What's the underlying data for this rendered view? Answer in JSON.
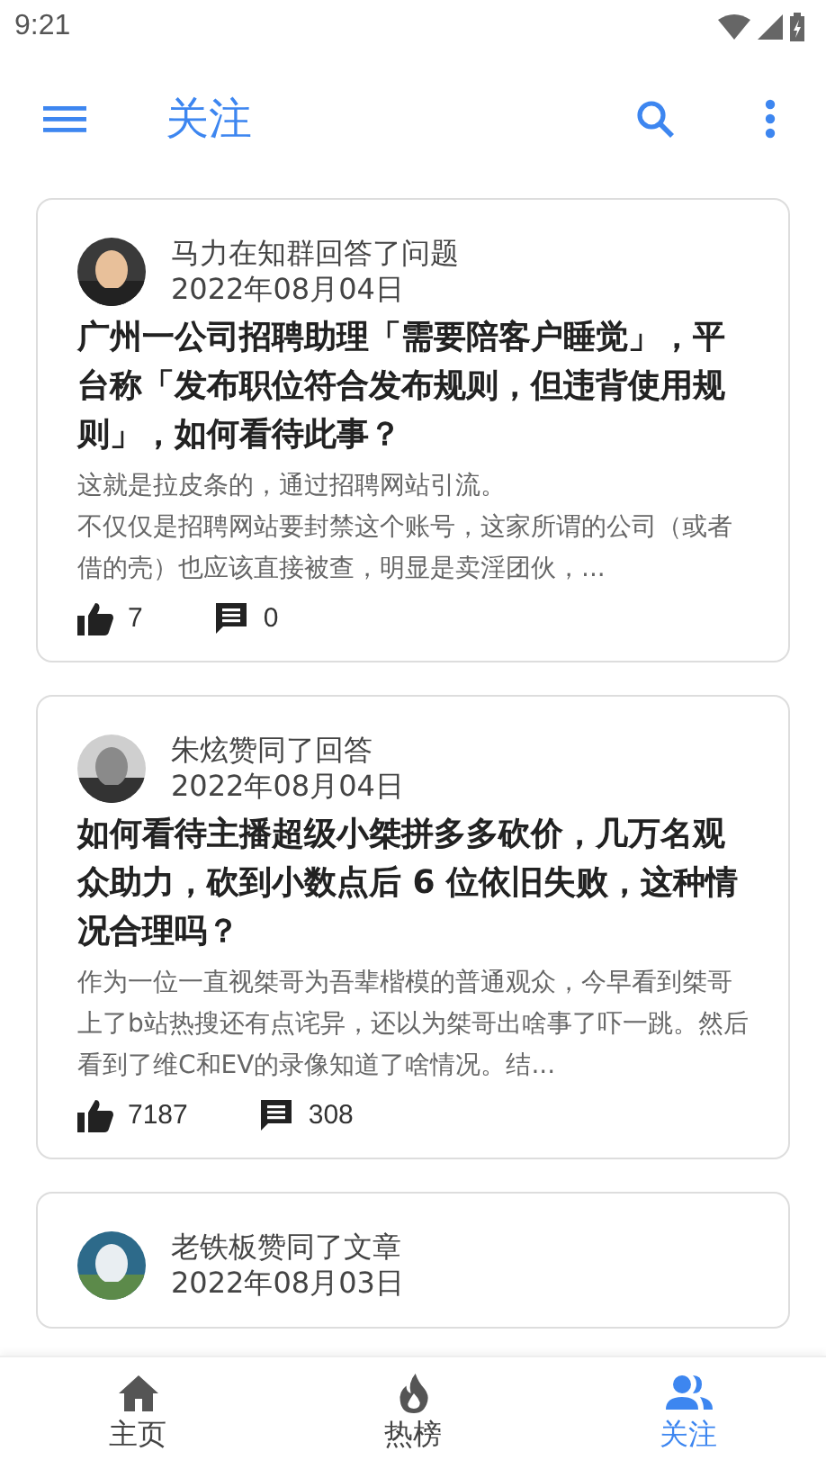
{
  "status_bar": {
    "time": "9:21"
  },
  "app_bar": {
    "title": "关注"
  },
  "feed": [
    {
      "activity": "马力在知群回答了问题",
      "date": "2022年08月04日",
      "title": "广州一公司招聘助理「需要陪客户睡觉」，平台称「发布职位符合发布规则，但违背使用规则」，如何看待此事？",
      "excerpt_lines": [
        "这就是拉皮条的，通过招聘网站引流。",
        "不仅仅是招聘网站要封禁这个账号，这家所谓的公司（或者借的壳）也应该直接被查，明显是卖淫团伙，..."
      ],
      "likes": "7",
      "comments": "0"
    },
    {
      "activity": "朱炫赞同了回答",
      "date": "2022年08月04日",
      "title": "如何看待主播超级小桀拼多多砍价，几万名观众助力，砍到小数点后 6 位依旧失败，这种情况合理吗？",
      "excerpt_lines": [
        "作为一位一直视桀哥为吾辈楷模的普通观众，今早看到桀哥上了b站热搜还有点诧异，还以为桀哥出啥事了吓一跳。然后看到了维C和EV的录像知道了啥情况。结..."
      ],
      "likes": "7187",
      "comments": "308"
    },
    {
      "activity": "老铁板赞同了文章",
      "date": "2022年08月03日"
    }
  ],
  "bottom_nav": [
    {
      "label": "主页",
      "kind": "home",
      "selected": false
    },
    {
      "label": "热榜",
      "kind": "hot",
      "selected": false
    },
    {
      "label": "关注",
      "kind": "following",
      "selected": true
    }
  ]
}
